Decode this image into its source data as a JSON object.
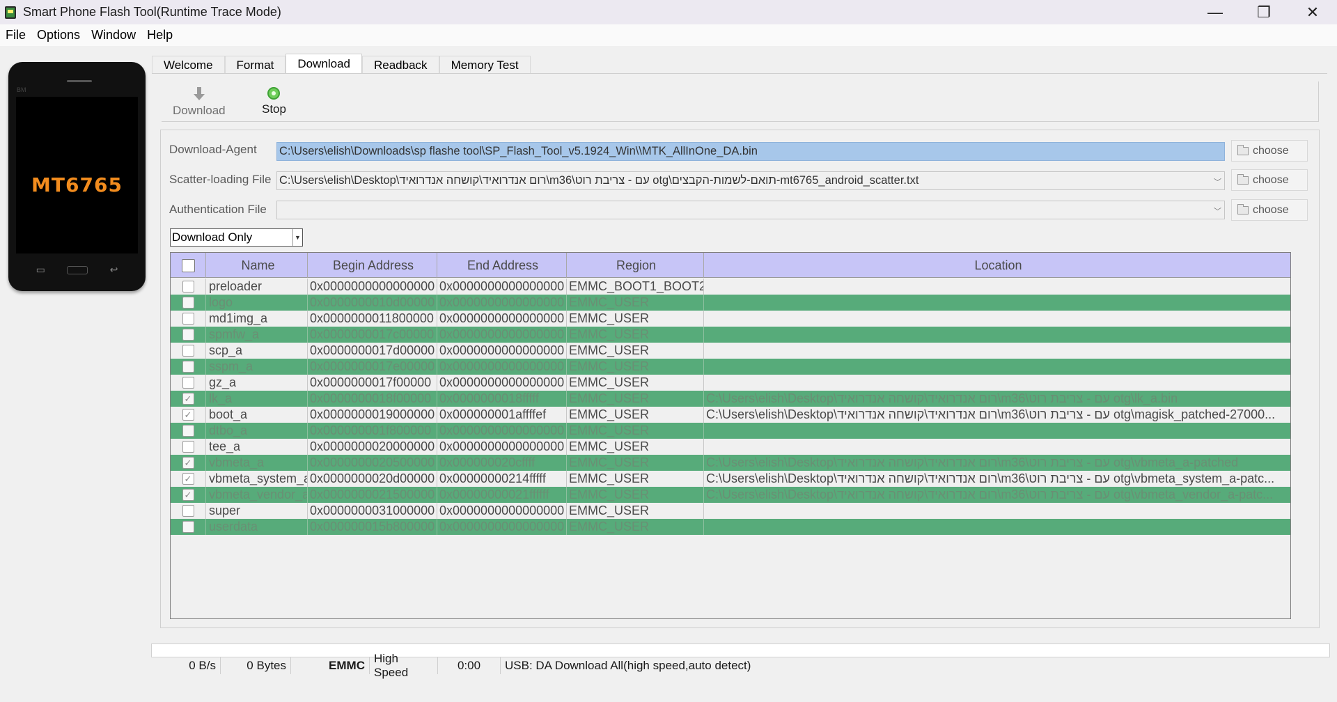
{
  "window": {
    "title": "Smart Phone Flash Tool(Runtime Trace Mode)",
    "minimize": "—",
    "restore": "❐",
    "close": "✕"
  },
  "menu": [
    "File",
    "Options",
    "Window",
    "Help"
  ],
  "phone": {
    "chip": "MT6765",
    "brand": "BM"
  },
  "tabs": [
    "Welcome",
    "Format",
    "Download",
    "Readback",
    "Memory Test"
  ],
  "active_tab": "Download",
  "toolbar": {
    "download_label": "Download",
    "stop_label": "Stop"
  },
  "fields": {
    "download_agent_label": "Download-Agent",
    "download_agent_value": "C:\\Users\\elish\\Downloads\\sp flashe tool\\SP_Flash_Tool_v5.1924_Win\\\\MTK_AllInOne_DA.bin",
    "scatter_label": "Scatter-loading File",
    "scatter_value": "C:\\Users\\elish\\Desktop\\רום אנדרואיד\\קושחה אנדרואיד\\m36\\עם - צריבת רוט otg\\תואם-לשמות-הקבצים-mt6765_android_scatter.txt",
    "auth_label": "Authentication File",
    "auth_value": "",
    "choose": "choose"
  },
  "mode": "Download Only",
  "table": {
    "headers": [
      "Name",
      "Begin Address",
      "End Address",
      "Region",
      "Location"
    ],
    "rows": [
      {
        "checked": false,
        "name": "preloader",
        "begin": "0x0000000000000000",
        "end": "0x0000000000000000",
        "region": "EMMC_BOOT1_BOOT2",
        "location": ""
      },
      {
        "checked": false,
        "name": "logo",
        "begin": "0x0000000010d00000",
        "end": "0x0000000000000000",
        "region": "EMMC_USER",
        "location": ""
      },
      {
        "checked": false,
        "name": "md1img_a",
        "begin": "0x0000000011800000",
        "end": "0x0000000000000000",
        "region": "EMMC_USER",
        "location": ""
      },
      {
        "checked": false,
        "name": "spmfw_a",
        "begin": "0x0000000017c00000",
        "end": "0x0000000000000000",
        "region": "EMMC_USER",
        "location": ""
      },
      {
        "checked": false,
        "name": "scp_a",
        "begin": "0x0000000017d00000",
        "end": "0x0000000000000000",
        "region": "EMMC_USER",
        "location": ""
      },
      {
        "checked": false,
        "name": "sspm_a",
        "begin": "0x0000000017e00000",
        "end": "0x0000000000000000",
        "region": "EMMC_USER",
        "location": ""
      },
      {
        "checked": false,
        "name": "gz_a",
        "begin": "0x0000000017f00000",
        "end": "0x0000000000000000",
        "region": "EMMC_USER",
        "location": ""
      },
      {
        "checked": true,
        "name": "lk_a",
        "begin": "0x0000000018f00000",
        "end": "0x0000000018fffff",
        "region": "EMMC_USER",
        "location": "C:\\Users\\elish\\Desktop\\רום אנדרואיד\\קושחה אנדרואיד\\m36\\עם - צריבת רוט otg\\lk_a.bin"
      },
      {
        "checked": true,
        "name": "boot_a",
        "begin": "0x0000000019000000",
        "end": "0x000000001affffef",
        "region": "EMMC_USER",
        "location": "C:\\Users\\elish\\Desktop\\רום אנדרואיד\\קושחה אנדרואיד\\m36\\עם - צריבת רוט otg\\magisk_patched-27000..."
      },
      {
        "checked": false,
        "name": "dtbo_a",
        "begin": "0x000000001f800000",
        "end": "0x0000000000000000",
        "region": "EMMC_USER",
        "location": ""
      },
      {
        "checked": false,
        "name": "tee_a",
        "begin": "0x0000000020000000",
        "end": "0x0000000000000000",
        "region": "EMMC_USER",
        "location": ""
      },
      {
        "checked": true,
        "name": "vbmeta_a",
        "begin": "0x0000000020500000",
        "end": "0x000000020cffff",
        "region": "EMMC_USER",
        "location": "C:\\Users\\elish\\Desktop\\רום אנדרואיד\\קושחה אנדרואיד\\m36\\עם - צריבת רוט otg\\vbmeta_a-patched"
      },
      {
        "checked": true,
        "name": "vbmeta_system_a",
        "begin": "0x0000000020d00000",
        "end": "0x00000000214fffff",
        "region": "EMMC_USER",
        "location": "C:\\Users\\elish\\Desktop\\רום אנדרואיד\\קושחה אנדרואיד\\m36\\עם - צריבת רוט otg\\vbmeta_system_a-patc..."
      },
      {
        "checked": true,
        "name": "vbmeta_vendor_a",
        "begin": "0x0000000021500000",
        "end": "0x00000000021ffffff",
        "region": "EMMC_USER",
        "location": "C:\\Users\\elish\\Desktop\\רום אנדרואיד\\קושחה אנדרואיד\\m36\\עם - צריבת רוט otg\\vbmeta_vendor_a-patc..."
      },
      {
        "checked": false,
        "name": "super",
        "begin": "0x0000000031000000",
        "end": "0x0000000000000000",
        "region": "EMMC_USER",
        "location": ""
      },
      {
        "checked": false,
        "name": "userdata",
        "begin": "0x000000015b800000",
        "end": "0x0000000000000000",
        "region": "EMMC_USER",
        "location": ""
      }
    ]
  },
  "status": {
    "speed": "0 B/s",
    "bytes": "0 Bytes",
    "storage": "EMMC",
    "usb_speed": "High Speed",
    "time": "0:00",
    "message": "USB: DA Download All(high speed,auto detect)"
  },
  "colors": {
    "header_bg": "#c7c5f7",
    "alt_row": "#57ab7a",
    "agent_highlight": "#a7c7ea",
    "chip_text": "#f28c1e"
  }
}
